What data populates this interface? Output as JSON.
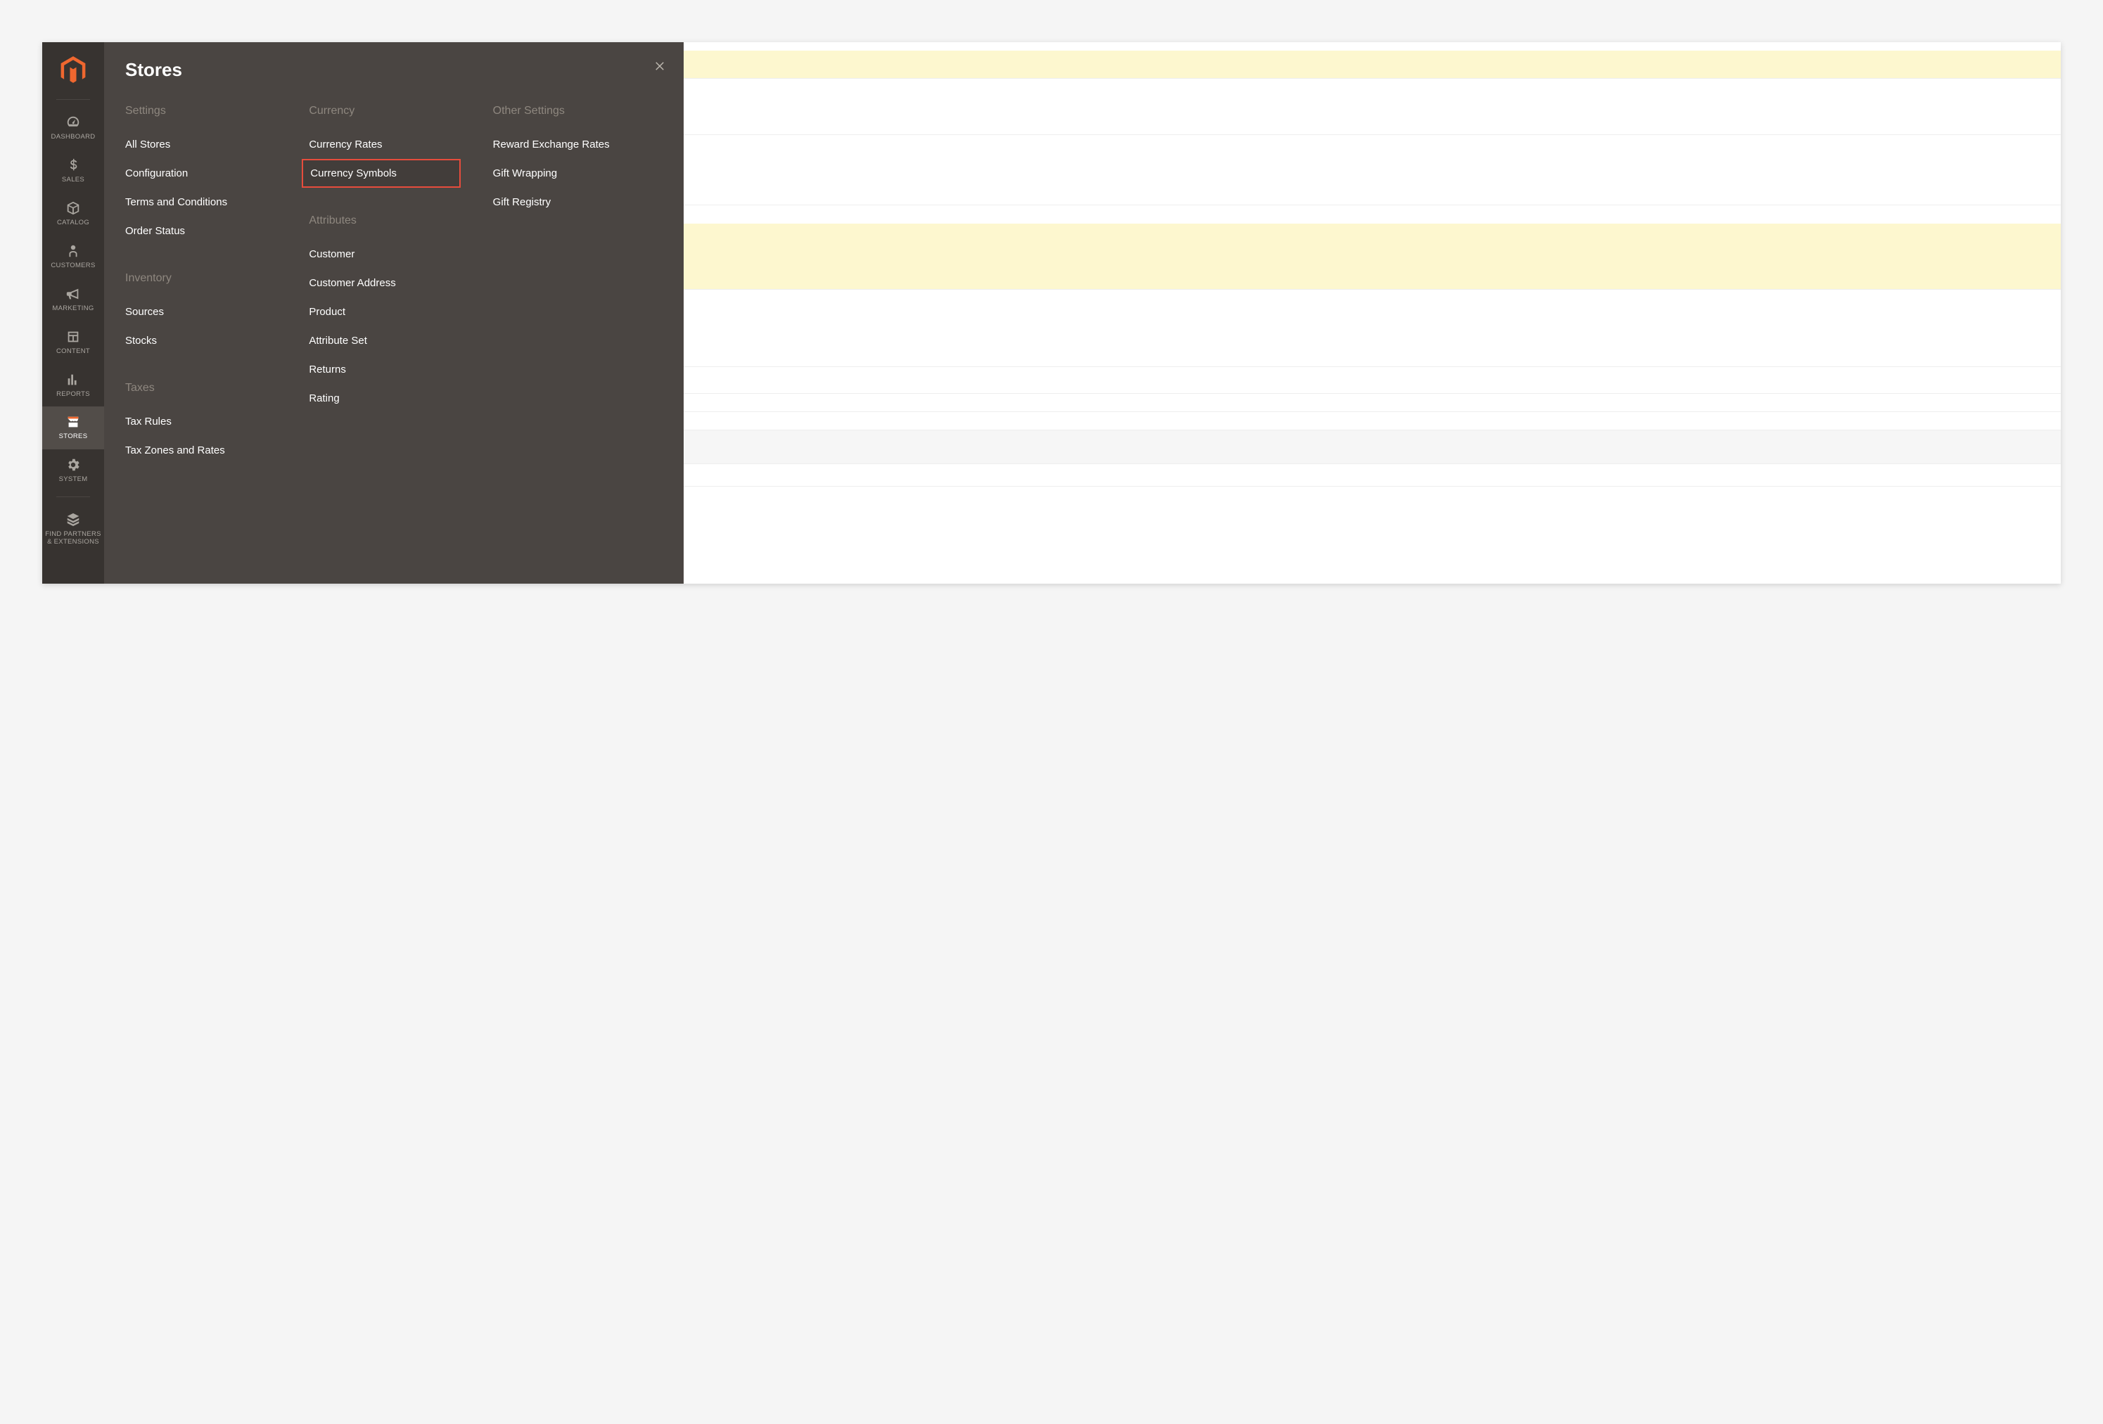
{
  "sidebar": {
    "items": [
      {
        "label": "DASHBOARD"
      },
      {
        "label": "SALES"
      },
      {
        "label": "CATALOG"
      },
      {
        "label": "CUSTOMERS"
      },
      {
        "label": "MARKETING"
      },
      {
        "label": "CONTENT"
      },
      {
        "label": "REPORTS"
      },
      {
        "label": "STORES"
      },
      {
        "label": "SYSTEM"
      },
      {
        "label": "FIND PARTNERS & EXTENSIONS"
      }
    ]
  },
  "flyout": {
    "title": "Stores",
    "columns": [
      {
        "sections": [
          {
            "heading": "Settings",
            "items": [
              "All Stores",
              "Configuration",
              "Terms and Conditions",
              "Order Status"
            ]
          },
          {
            "heading": "Inventory",
            "items": [
              "Sources",
              "Stocks"
            ]
          },
          {
            "heading": "Taxes",
            "items": [
              "Tax Rules",
              "Tax Zones and Rates"
            ]
          }
        ]
      },
      {
        "sections": [
          {
            "heading": "Currency",
            "items": [
              "Currency Rates",
              "Currency Symbols"
            ],
            "highlighted_index": 1
          },
          {
            "heading": "Attributes",
            "items": [
              "Customer",
              "Customer Address",
              "Product",
              "Attribute Set",
              "Returns",
              "Rating"
            ]
          }
        ]
      },
      {
        "sections": [
          {
            "heading": "Other Settings",
            "items": [
              "Reward Exchange Rates",
              "Gift Wrapping",
              "Gift Registry"
            ]
          }
        ]
      }
    ]
  }
}
